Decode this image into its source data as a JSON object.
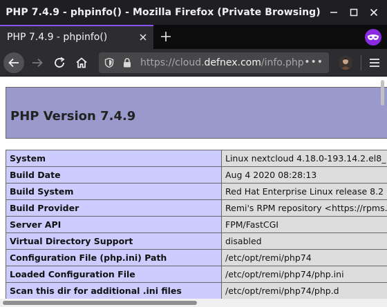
{
  "window": {
    "title": "PHP 7.4.9 - phpinfo() - Mozilla Firefox (Private Browsing)"
  },
  "tab": {
    "title": "PHP 7.4.9 - phpinfo()"
  },
  "urlbar": {
    "scheme": "https://cloud.",
    "host": "defnex.com",
    "path": "/info.php",
    "more_label": "•••"
  },
  "page": {
    "heading": "PHP Version 7.4.9",
    "rows": [
      {
        "key": "System",
        "value": "Linux nextcloud 4.18.0-193.14.2.el8_"
      },
      {
        "key": "Build Date",
        "value": "Aug 4 2020 08:28:13"
      },
      {
        "key": "Build System",
        "value": "Red Hat Enterprise Linux release 8.2"
      },
      {
        "key": "Build Provider",
        "value": "Remi's RPM repository <https://rpms."
      },
      {
        "key": "Server API",
        "value": "FPM/FastCGI"
      },
      {
        "key": "Virtual Directory Support",
        "value": "disabled"
      },
      {
        "key": "Configuration File (php.ini) Path",
        "value": "/etc/opt/remi/php74"
      },
      {
        "key": "Loaded Configuration File",
        "value": "/etc/opt/remi/php74/php.ini"
      },
      {
        "key": "Scan this dir for additional .ini files",
        "value": "/etc/opt/remi/php74/php.d"
      }
    ]
  },
  "colors": {
    "private_accent": "#8a2be2",
    "header_bg": "#9999cc",
    "key_cell_bg": "#ccccff",
    "value_cell_bg": "#dddddd"
  }
}
